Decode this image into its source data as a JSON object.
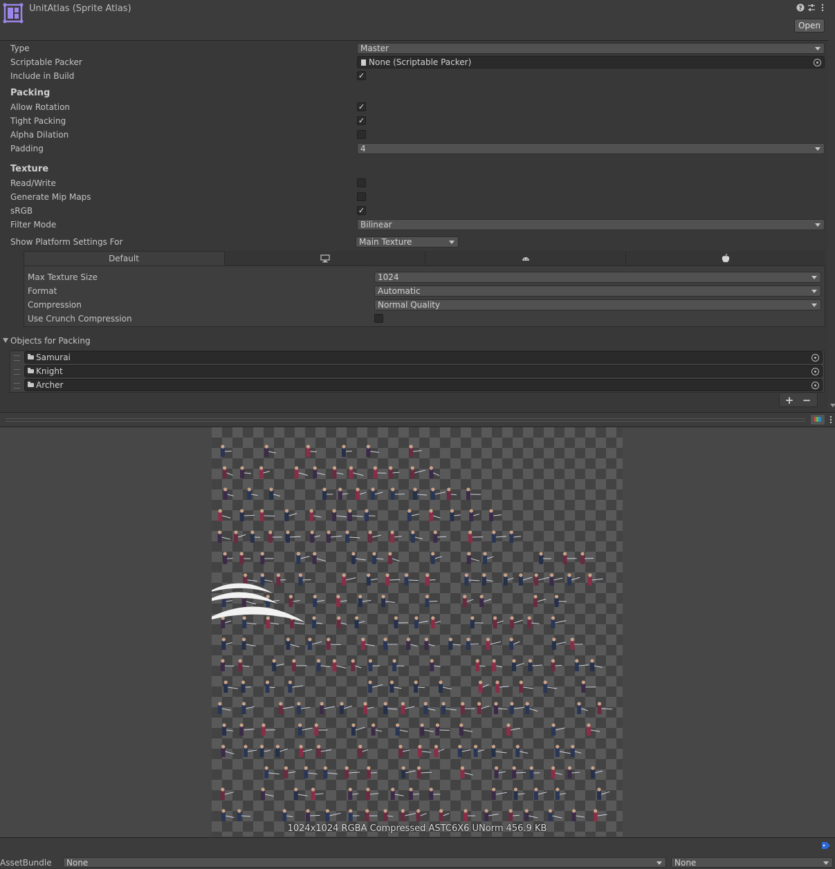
{
  "header": {
    "title": "UnitAtlas (Sprite Atlas)",
    "open_label": "Open",
    "icons": [
      "help-icon",
      "preset-icon",
      "more-menu-icon"
    ]
  },
  "settings": {
    "type_label": "Type",
    "type_value": "Master",
    "scriptable_packer_label": "Scriptable Packer",
    "scriptable_packer_value": "None (Scriptable Packer)",
    "include_in_build_label": "Include in Build",
    "include_in_build": true
  },
  "packing": {
    "header": "Packing",
    "allow_rotation_label": "Allow Rotation",
    "allow_rotation": true,
    "tight_packing_label": "Tight Packing",
    "tight_packing": true,
    "alpha_dilation_label": "Alpha Dilation",
    "alpha_dilation": false,
    "padding_label": "Padding",
    "padding_value": "4"
  },
  "texture": {
    "header": "Texture",
    "read_write_label": "Read/Write",
    "read_write": false,
    "generate_mip_maps_label": "Generate Mip Maps",
    "generate_mip_maps": false,
    "srgb_label": "sRGB",
    "srgb": true,
    "filter_mode_label": "Filter Mode",
    "filter_mode_value": "Bilinear"
  },
  "platform": {
    "show_for_label": "Show Platform Settings For",
    "show_for_value": "Main Texture",
    "tabs": [
      {
        "label": "Default",
        "icon": ""
      },
      {
        "label": "",
        "icon": "monitor-icon"
      },
      {
        "label": "",
        "icon": "android-icon"
      },
      {
        "label": "",
        "icon": "apple-icon"
      }
    ],
    "max_texture_size_label": "Max Texture Size",
    "max_texture_size_value": "1024",
    "format_label": "Format",
    "format_value": "Automatic",
    "compression_label": "Compression",
    "compression_value": "Normal Quality",
    "use_crunch_label": "Use Crunch Compression",
    "use_crunch": false
  },
  "objects": {
    "header": "Objects for Packing",
    "items": [
      "Samurai",
      "Knight",
      "Archer"
    ],
    "add_label": "+",
    "remove_label": "−"
  },
  "preview": {
    "info": "1024x1024 RGBA Compressed ASTC6X6 UNorm   456.9 KB"
  },
  "bottom": {
    "assetbundle_label": "AssetBundle",
    "assetbundle_value": "None",
    "variant_value": "None"
  },
  "colors": {
    "background": "#383838",
    "accent_icon": "#9c86e8",
    "label_tag": "#2f6bd6"
  }
}
